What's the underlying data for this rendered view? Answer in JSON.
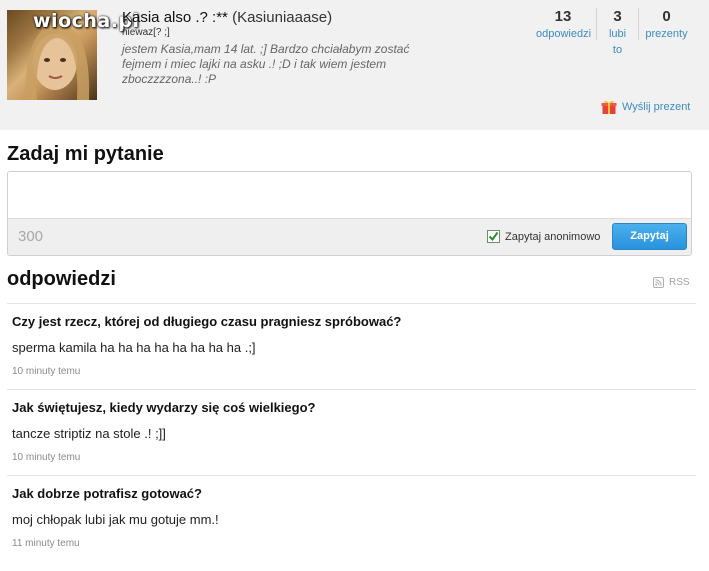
{
  "profile": {
    "watermark": "wiocha.pl",
    "display_name": "Kasia also .? :**",
    "username": "(Kasiuniaaase)",
    "status": "niewaz[? ;]",
    "bio": "jestem Kasia,mam 14 lat. ;] Bardzo chciałabym zostać fejmem i miec lajki na asku .! ;D i tak wiem jestem zboczzzzona..! :P",
    "stats": [
      {
        "value": "13",
        "label": "odpowiedzi"
      },
      {
        "value": "3",
        "label": "lubi to"
      },
      {
        "value": "0",
        "label": "prezenty"
      }
    ],
    "gift_link": "Wyślij prezent",
    "gift_icon": "gift-icon"
  },
  "ask": {
    "title": "Zadaj mi pytanie",
    "value": "",
    "placeholder": "",
    "char_count": "300",
    "anonymous_label": "Zapytaj anonimowo",
    "anonymous_checked": true,
    "submit_label": "Zapytaj",
    "accent_color": "#2992dd"
  },
  "answers": {
    "title": "odpowiedzi",
    "rss_label": "RSS",
    "items": [
      {
        "question": "Czy jest rzecz, której od długiego czasu pragniesz spróbować?",
        "answer": "sperma kamila ha ha ha ha ha ha ha ha .;]",
        "time": "10 minuty temu"
      },
      {
        "question": "Jak świętujesz, kiedy wydarzy się coś wielkiego?",
        "answer": "tancze striptiz na stole .! ;]]",
        "time": "10 minuty temu"
      },
      {
        "question": "Jak dobrze potrafisz gotować?",
        "answer": "moj chłopak lubi jak mu gotuje mm.!",
        "time": "11 minuty temu"
      }
    ]
  },
  "colors": {
    "link": "#3d8bc4",
    "header_bg": "#f1f1f1",
    "button": "#2992dd"
  }
}
